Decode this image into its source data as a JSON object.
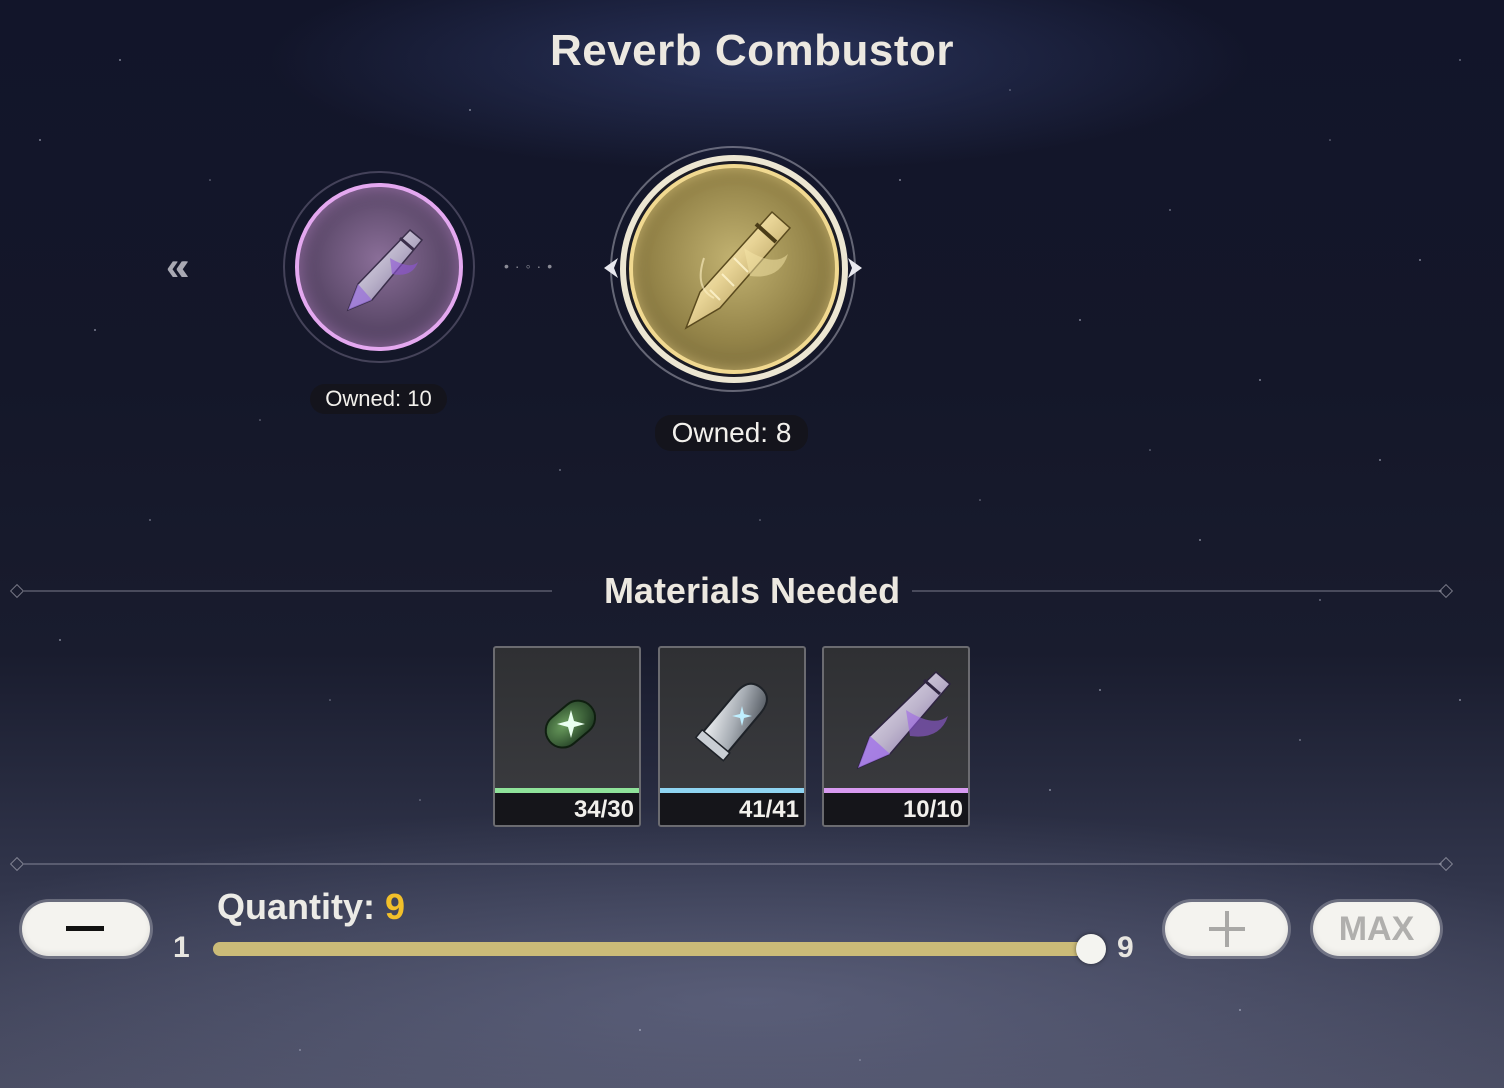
{
  "title": "Reverb Combustor",
  "source_item": {
    "owned_text": "Owned: 10",
    "rarity_color": "#e4a8f0"
  },
  "target_item": {
    "owned_text": "Owned: 8",
    "rarity_color": "#f1d990"
  },
  "materials": {
    "heading": "Materials Needed",
    "items": [
      {
        "icon": "green-shell-icon",
        "count": "34/30",
        "rarity_color": "#8fe29a"
      },
      {
        "icon": "silver-shell-icon",
        "count": "41/41",
        "rarity_color": "#8fd4f2"
      },
      {
        "icon": "purple-combustor-icon",
        "count": "10/10",
        "rarity_color": "#d79af0"
      }
    ]
  },
  "quantity": {
    "label": "Quantity:",
    "value": "9",
    "min": "1",
    "max": "9",
    "fill_fraction": 1.0
  },
  "buttons": {
    "max_label": "MAX"
  },
  "colors": {
    "accent_gold": "#f2c02a",
    "slider_fill": "#cbbb78"
  }
}
